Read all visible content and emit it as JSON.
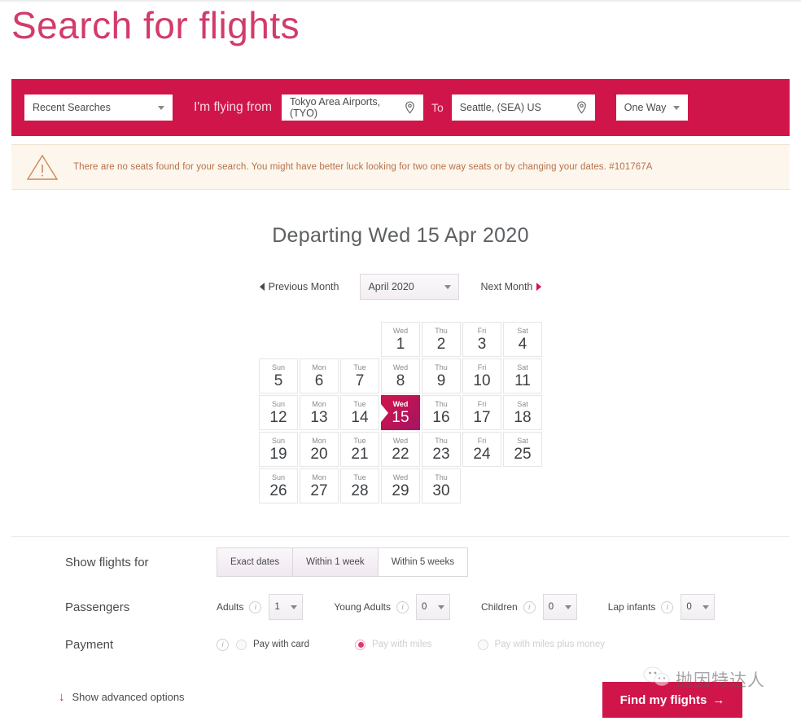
{
  "page_title": "Search for flights",
  "colors": {
    "brand_red": "#d0154b",
    "title_pink": "#d23b6a",
    "warning_bg": "#fdf6ec",
    "warning_text": "#b5714b",
    "selected_day_gradient_start": "#d0154b",
    "selected_day_gradient_end": "#a61463"
  },
  "searchbar": {
    "recent_searches": "Recent Searches",
    "flying_from_label": "I'm flying from",
    "origin": "Tokyo Area Airports, (TYO)",
    "to_label": "To",
    "destination": "Seattle, (SEA) US",
    "trip_type": "One Way"
  },
  "warning": {
    "message": "There are no seats found for your search. You might have better luck looking for two one way seats or by changing your dates. #101767A"
  },
  "calendar": {
    "departing_heading": "Departing Wed 15 Apr 2020",
    "previous_month": "Previous Month",
    "next_month": "Next Month",
    "month_value": "April 2020",
    "selected_day": 15,
    "leading_blanks": 3,
    "days": [
      {
        "dow": "Wed",
        "num": "1"
      },
      {
        "dow": "Thu",
        "num": "2"
      },
      {
        "dow": "Fri",
        "num": "3"
      },
      {
        "dow": "Sat",
        "num": "4"
      },
      {
        "dow": "Sun",
        "num": "5"
      },
      {
        "dow": "Mon",
        "num": "6"
      },
      {
        "dow": "Tue",
        "num": "7"
      },
      {
        "dow": "Wed",
        "num": "8"
      },
      {
        "dow": "Thu",
        "num": "9"
      },
      {
        "dow": "Fri",
        "num": "10"
      },
      {
        "dow": "Sat",
        "num": "11"
      },
      {
        "dow": "Sun",
        "num": "12"
      },
      {
        "dow": "Mon",
        "num": "13"
      },
      {
        "dow": "Tue",
        "num": "14"
      },
      {
        "dow": "Wed",
        "num": "15"
      },
      {
        "dow": "Thu",
        "num": "16"
      },
      {
        "dow": "Fri",
        "num": "17"
      },
      {
        "dow": "Sat",
        "num": "18"
      },
      {
        "dow": "Sun",
        "num": "19"
      },
      {
        "dow": "Mon",
        "num": "20"
      },
      {
        "dow": "Tue",
        "num": "21"
      },
      {
        "dow": "Wed",
        "num": "22"
      },
      {
        "dow": "Thu",
        "num": "23"
      },
      {
        "dow": "Fri",
        "num": "24"
      },
      {
        "dow": "Sat",
        "num": "25"
      },
      {
        "dow": "Sun",
        "num": "26"
      },
      {
        "dow": "Mon",
        "num": "27"
      },
      {
        "dow": "Tue",
        "num": "28"
      },
      {
        "dow": "Wed",
        "num": "29"
      },
      {
        "dow": "Thu",
        "num": "30"
      }
    ]
  },
  "options": {
    "show_flights_label": "Show flights for",
    "flexibility": [
      {
        "label": "Exact dates",
        "selected": false
      },
      {
        "label": "Within 1 week",
        "selected": false
      },
      {
        "label": "Within 5 weeks",
        "selected": true
      }
    ],
    "passengers_label": "Passengers",
    "passengers": [
      {
        "name": "Adults",
        "value": "1"
      },
      {
        "name": "Young Adults",
        "value": "0"
      },
      {
        "name": "Children",
        "value": "0"
      },
      {
        "name": "Lap infants",
        "value": "0"
      }
    ],
    "payment_label": "Payment",
    "payment_options": [
      {
        "label": "Pay with card",
        "selected": false
      },
      {
        "label": "Pay with miles",
        "selected": true
      },
      {
        "label": "Pay with miles plus money",
        "selected": false
      }
    ]
  },
  "footer": {
    "advanced_options": "Show advanced options",
    "find_button": "Find my flights",
    "find_button_arrow": "→",
    "advanced_arrow": "↓",
    "watermark_text": "抛因特达人"
  }
}
